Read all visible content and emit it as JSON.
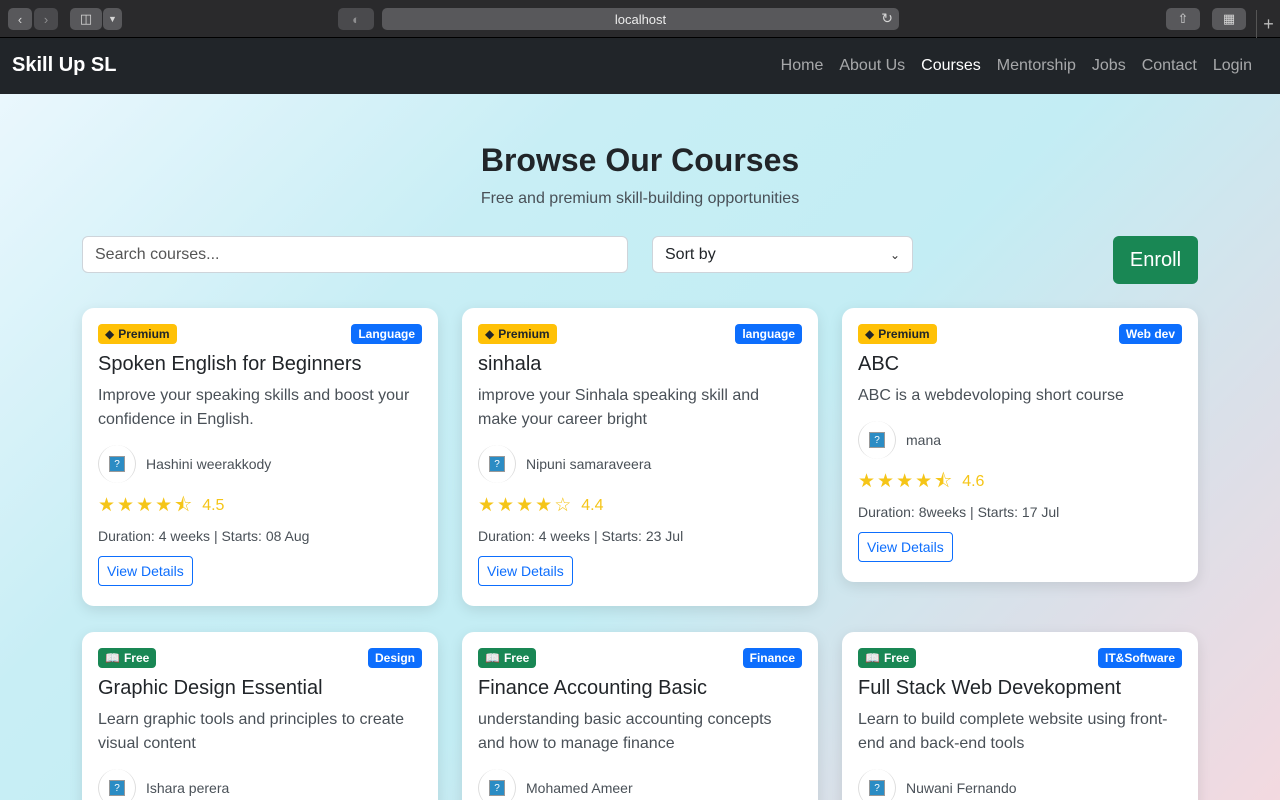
{
  "browser": {
    "url": "localhost"
  },
  "navbar": {
    "brand": "Skill Up SL",
    "links": [
      "Home",
      "About Us",
      "Courses",
      "Mentorship",
      "Jobs",
      "Contact",
      "Login"
    ],
    "active": "Courses"
  },
  "hero": {
    "title": "Browse Our Courses",
    "subtitle": "Free and premium skill-building opportunities"
  },
  "controls": {
    "search_placeholder": "Search courses...",
    "sort_label": "Sort by",
    "enroll_label": "Enroll"
  },
  "colors": {
    "premium": "#ffc107",
    "free": "#198754",
    "category": "#0d6efd",
    "star": "#f5c518"
  },
  "courses": [
    {
      "tier": "Premium",
      "category": "Language",
      "title": "Spoken English for Beginners",
      "description": "Improve your speaking skills and boost your confidence in English.",
      "instructor": "Hashini weerakkody",
      "rating": "4.5",
      "meta": "Duration: 4 weeks | Starts: 08 Aug",
      "button": "View Details"
    },
    {
      "tier": "Premium",
      "category": "language",
      "title": "sinhala",
      "description": "improve your Sinhala speaking skill and make your career bright",
      "instructor": "Nipuni samaraveera",
      "rating": "4.4",
      "meta": "Duration: 4 weeks | Starts: 23 Jul",
      "button": "View Details"
    },
    {
      "tier": "Premium",
      "category": "Web dev",
      "title": "ABC",
      "description": "ABC is a webdevoloping short course",
      "instructor": "mana",
      "rating": "4.6",
      "meta": "Duration: 8weeks | Starts: 17 Jul",
      "button": "View Details"
    },
    {
      "tier": "Free",
      "category": "Design",
      "title": "Graphic Design Essential",
      "description": "Learn graphic tools and principles to create visual content",
      "instructor": "Ishara perera"
    },
    {
      "tier": "Free",
      "category": "Finance",
      "title": "Finance Accounting Basic",
      "description": "understanding basic accounting concepts and how to manage finance",
      "instructor": "Mohamed Ameer"
    },
    {
      "tier": "Free",
      "category": "IT&Software",
      "title": "Full Stack Web Devekopment",
      "description": "Learn to build complete website using front-end and back-end tools",
      "instructor": "Nuwani Fernando"
    }
  ]
}
